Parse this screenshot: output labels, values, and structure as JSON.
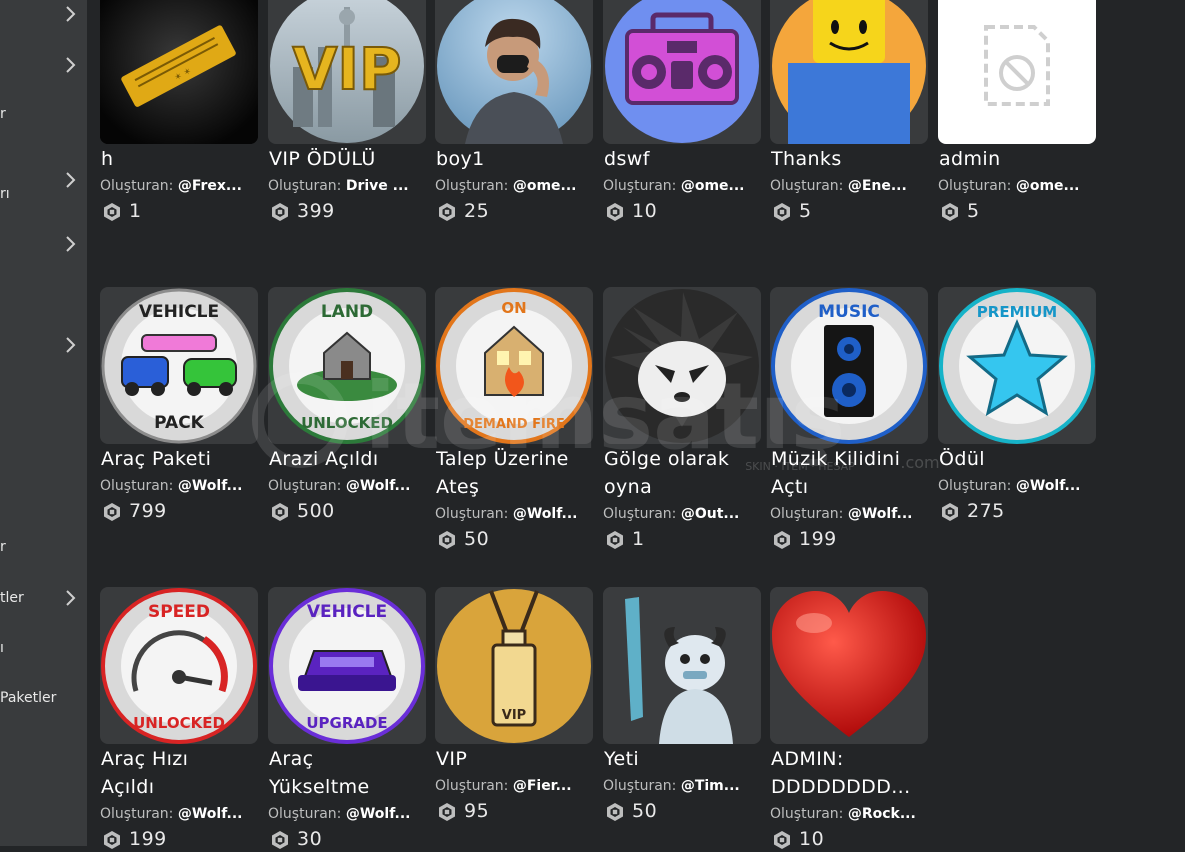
{
  "sidebar": {
    "items": [
      {
        "label": ""
      },
      {
        "label": ""
      },
      {
        "label": "r"
      },
      {
        "label": "rı"
      },
      {
        "label": ""
      },
      {
        "label": ""
      },
      {
        "label": "r"
      },
      {
        "label": "tler"
      },
      {
        "label": "ı"
      },
      {
        "label": "Paketler"
      }
    ]
  },
  "creator_prefix": "Oluşturan:",
  "passes": [
    {
      "name": "h",
      "creator": "@Frex...",
      "price": "1",
      "icon": "gold-ticket-icon"
    },
    {
      "name": "VIP ÖDÜLÜ",
      "creator": "Drive ...",
      "price": "399",
      "icon": "vip-city-icon"
    },
    {
      "name": "boy1",
      "creator": "@ome...",
      "price": "25",
      "icon": "boy-photo-icon"
    },
    {
      "name": "dswf",
      "creator": "@ome...",
      "price": "10",
      "icon": "boombox-icon"
    },
    {
      "name": "Thanks",
      "creator": "@Ene...",
      "price": "5",
      "icon": "smiley-avatar-icon"
    },
    {
      "name": "admin",
      "creator": "@ome...",
      "price": "5",
      "icon": "broken-image-icon"
    },
    {
      "name": "Araç Paketi",
      "creator": "@Wolf...",
      "price": "799",
      "icon": "vehicle-pack-icon",
      "badge": "VEHICLE",
      "badge2": "PACK"
    },
    {
      "name": "Arazi Açıldı",
      "creator": "@Wolf...",
      "price": "500",
      "icon": "land-unlocked-icon",
      "badge": "LAND",
      "badge2": "UNLOCKED"
    },
    {
      "name": "Talep Üzerine Ateş",
      "creator": "@Wolf...",
      "price": "50",
      "icon": "on-demand-fire-icon",
      "badge": "ON",
      "badge2": "DEMAND FIRE"
    },
    {
      "name": "Gölge olarak oyna",
      "creator": "@Out...",
      "price": "1",
      "icon": "shadow-hedgehog-icon"
    },
    {
      "name": "Müzik Kilidini Açtı",
      "creator": "@Wolf...",
      "price": "199",
      "icon": "music-speaker-icon",
      "badge": "MUSIC"
    },
    {
      "name": "Ödül",
      "creator": "@Wolf...",
      "price": "275",
      "icon": "premium-star-icon",
      "badge": "PREMIUM"
    },
    {
      "name": "Araç Hızı Açıldı",
      "creator": "@Wolf...",
      "price": "199",
      "icon": "speed-unlocked-icon",
      "badge": "SPEED",
      "badge2": "UNLOCKED"
    },
    {
      "name": "Araç Yükseltme",
      "creator": "@Wolf...",
      "price": "30",
      "icon": "vehicle-upgrade-icon",
      "badge": "VEHICLE",
      "badge2": "UPGRADE"
    },
    {
      "name": "VIP",
      "creator": "@Fier...",
      "price": "95",
      "icon": "vip-lanyard-icon",
      "badge": "VIP"
    },
    {
      "name": "Yeti",
      "creator": "@Tim...",
      "price": "50",
      "icon": "yeti-icon"
    },
    {
      "name": "ADMIN: DDDDDDDD...",
      "creator": "@Rock...",
      "price": "10",
      "icon": "red-heart-icon"
    }
  ],
  "watermark": {
    "text": "itemsatış",
    "sub": "SKIN · ITEM · HESAP",
    "suffix": ".com"
  }
}
